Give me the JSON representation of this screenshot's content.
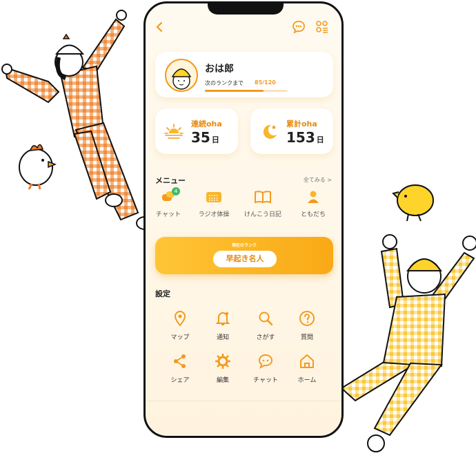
{
  "header": {
    "back_icon": "chevron-left-icon",
    "chat_icon": "chat-icon",
    "menu_icon": "grid-menu-icon"
  },
  "profile": {
    "name": "おは郎",
    "rank_label": "次のランクまで",
    "rank_progress": "85/120",
    "progress_fraction": 0.708
  },
  "stats": [
    {
      "label": "連続oha",
      "value": "35",
      "unit": "日",
      "icon": "sunrise-icon"
    },
    {
      "label": "累計oha",
      "value": "153",
      "unit": "日",
      "icon": "moon-icon"
    }
  ],
  "menu": {
    "title": "メニュー",
    "see_all": "全てみる >",
    "items": [
      {
        "label": "チャット",
        "icon": "chat-bubbles-icon",
        "badge": "4"
      },
      {
        "label": "ラジオ体操",
        "icon": "radio-icon"
      },
      {
        "label": "けんこう日記",
        "icon": "book-icon"
      },
      {
        "label": "ともだち",
        "icon": "person-icon"
      }
    ]
  },
  "rank": {
    "caption": "現在のランク",
    "value": "早起き名人"
  },
  "settings": {
    "title": "設定",
    "items": [
      {
        "label": "マップ",
        "icon": "map-pin-icon"
      },
      {
        "label": "通知",
        "icon": "bell-icon"
      },
      {
        "label": "さがす",
        "icon": "search-icon"
      },
      {
        "label": "質問",
        "icon": "question-icon"
      },
      {
        "label": "シェア",
        "icon": "share-icon"
      },
      {
        "label": "編集",
        "icon": "gear-icon"
      },
      {
        "label": "チャット",
        "icon": "chat-icon"
      },
      {
        "label": "ホーム",
        "icon": "home-icon"
      }
    ]
  },
  "colors": {
    "accent": "#f39a1e",
    "accent_light": "#ffc536",
    "badge": "#47b96b"
  }
}
